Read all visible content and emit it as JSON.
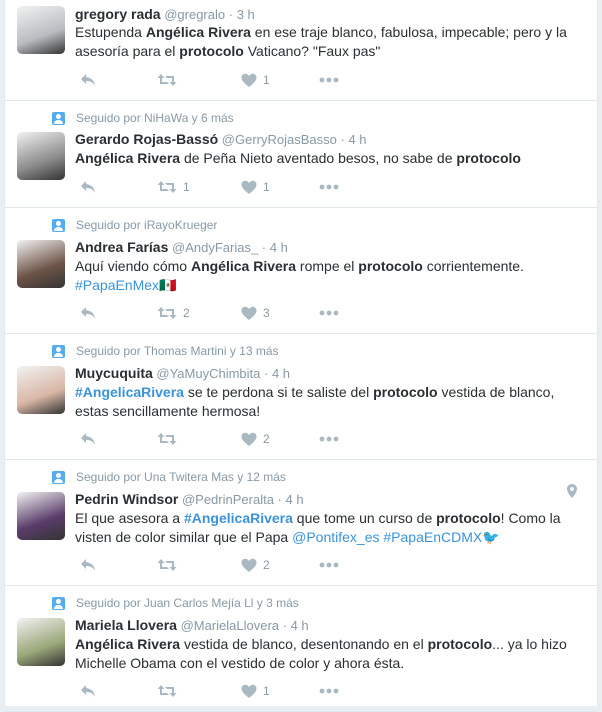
{
  "tweets": [
    {
      "context": "",
      "name": "gregory rada",
      "handle": "@gregralo",
      "time": "3 h",
      "text": [
        {
          "t": "Estupenda "
        },
        {
          "t": "Angélica Rivera",
          "b": true
        },
        {
          "t": " en ese traje blanco, fabulosa, impecable; pero y la asesoría para el "
        },
        {
          "t": "protocolo",
          "b": true
        },
        {
          "t": " Vaticano?  \"Faux pas\""
        }
      ],
      "retweets": "",
      "likes": "1",
      "avatar_color": "#b9bcc0"
    },
    {
      "context": "Seguido por NiHaWa y 6 más",
      "name": "Gerardo Rojas-Bassó",
      "handle": "@GerryRojasBasso",
      "time": "4 h",
      "text": [
        {
          "t": "Angélica Rivera",
          "b": true
        },
        {
          "t": " de Peña Nieto aventado besos, no sabe de "
        },
        {
          "t": "protocolo",
          "b": true
        }
      ],
      "retweets": "1",
      "likes": "1",
      "avatar_color": "#8c8c8c"
    },
    {
      "context": "Seguido por iRayoKrueger",
      "name": "Andrea Farías",
      "handle": "@AndyFarias_",
      "time": "4 h",
      "text": [
        {
          "t": "Aquí viendo cómo "
        },
        {
          "t": "Angélica Rivera",
          "b": true
        },
        {
          "t": " rompe el "
        },
        {
          "t": "protocolo",
          "b": true
        },
        {
          "t": " corrientemente. "
        },
        {
          "t": "#PapaEnMex",
          "link": true
        },
        {
          "t": "🇲🇽"
        }
      ],
      "retweets": "2",
      "likes": "3",
      "avatar_color": "#6e5448"
    },
    {
      "context": "Seguido por Thomas Martini y 13 más",
      "name": "Muycuquita",
      "handle": "@YaMuyChimbita",
      "time": "4 h",
      "text": [
        {
          "t": "#AngelicaRivera",
          "link": true,
          "b": true
        },
        {
          "t": " se te perdona si te saliste del "
        },
        {
          "t": "protocolo",
          "b": true
        },
        {
          "t": " vestida de blanco, estas sencillamente hermosa!"
        }
      ],
      "retweets": "",
      "likes": "2",
      "avatar_color": "#d9b7a6"
    },
    {
      "context": "Seguido por Una Twitera Mas y 12 más",
      "name": "Pedrin Windsor",
      "handle": "@PedrinPeralta",
      "time": "4 h",
      "text": [
        {
          "t": "El que asesora a "
        },
        {
          "t": "#AngelicaRivera",
          "link": true,
          "b": true
        },
        {
          "t": " que tome un curso de "
        },
        {
          "t": "protocolo",
          "b": true
        },
        {
          "t": "! Como la visten de color similar que el Papa "
        },
        {
          "t": "@Pontifex_es",
          "link": true
        },
        {
          "t": " "
        },
        {
          "t": "#PapaEnCDMX",
          "link": true
        },
        {
          "t": "🐦"
        }
      ],
      "retweets": "",
      "likes": "2",
      "avatar_color": "#5a3d6a"
    },
    {
      "context": "Seguido por Juan Carlos Mejía Ll y 3 más",
      "name": "Mariela Llovera",
      "handle": "@MarielaLlovera",
      "time": "4 h",
      "text": [
        {
          "t": "Angélica Rivera",
          "b": true
        },
        {
          "t": " vestida de blanco, desentonando en el "
        },
        {
          "t": "protocolo",
          "b": true
        },
        {
          "t": "... ya lo hizo Michelle Obama con el vestido de color y ahora ésta."
        }
      ],
      "retweets": "",
      "likes": "1",
      "avatar_color": "#9aa87a"
    }
  ],
  "icons": {
    "reply": "reply-icon",
    "retweet": "retweet-icon",
    "like": "heart-icon",
    "more": "more-icon",
    "location": "location-pin-icon"
  },
  "colors": {
    "link": "#3b94d9",
    "muted": "#8899a6",
    "icon": "#aab8c2",
    "badge": "#55acee"
  }
}
